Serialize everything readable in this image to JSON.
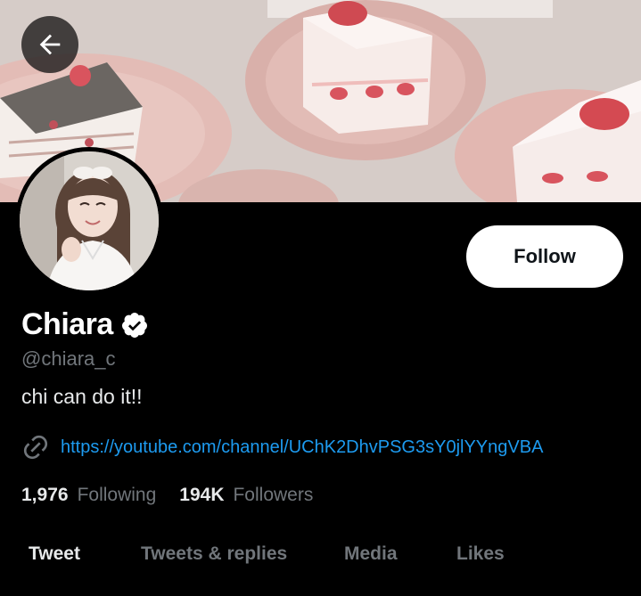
{
  "profile": {
    "name": "Chiara",
    "handle": "@chiara_c",
    "bio": "chi can do it!!",
    "link": "https://youtube.com/channel/UChK2DhvPSG3sY0jlYYngVBA",
    "verified": true
  },
  "actions": {
    "follow_label": "Follow"
  },
  "stats": {
    "following_count": "1,976",
    "following_label": "Following",
    "followers_count": "194K",
    "followers_label": "Followers"
  },
  "tabs": [
    {
      "label": "Tweet",
      "active": true
    },
    {
      "label": "Tweets & replies",
      "active": false
    },
    {
      "label": "Media",
      "active": false
    },
    {
      "label": "Likes",
      "active": false
    }
  ],
  "icons": {
    "back": "arrow-left-icon",
    "verified": "verified-badge-icon",
    "link": "link-icon"
  },
  "colors": {
    "background": "#000000",
    "accent_link": "#1d9bf0",
    "muted_text": "#71767b",
    "follow_button_bg": "#ffffff"
  }
}
